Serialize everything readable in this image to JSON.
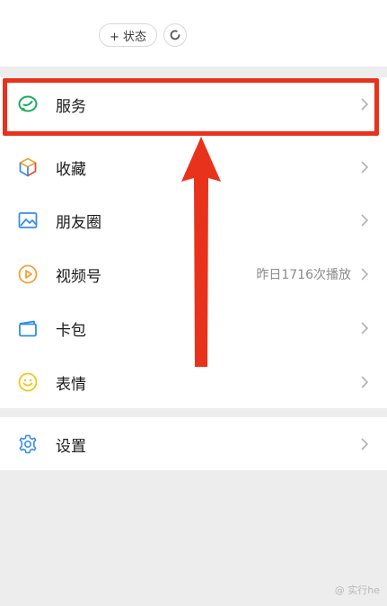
{
  "header": {
    "status_button_label": "+ 状态",
    "refresh_icon": "refresh-icon"
  },
  "menu": {
    "items": [
      {
        "label": "服务",
        "icon": "service-icon",
        "extra": ""
      },
      {
        "label": "收藏",
        "icon": "favorites-cube-icon",
        "extra": ""
      },
      {
        "label": "朋友圈",
        "icon": "moments-picture-icon",
        "extra": ""
      },
      {
        "label": "视频号",
        "icon": "channels-play-icon",
        "extra": "昨日1716次播放"
      },
      {
        "label": "卡包",
        "icon": "card-wallet-icon",
        "extra": ""
      },
      {
        "label": "表情",
        "icon": "sticker-smiley-icon",
        "extra": ""
      }
    ],
    "settings": {
      "label": "设置",
      "icon": "gear-icon"
    }
  },
  "annotation": {
    "highlight_color": "#e8321c",
    "highlight_target": "服务"
  },
  "watermark": {
    "text": "@ 实行he"
  },
  "colors": {
    "service_green": "#1aad5b",
    "cube_accent": "#f0a23a",
    "moments_blue": "#3a8ee6",
    "channels_orange": "#f0a23a",
    "card_blue": "#2f8ee6",
    "smiley_yellow": "#f5c518",
    "settings_blue": "#3a8ee6"
  }
}
